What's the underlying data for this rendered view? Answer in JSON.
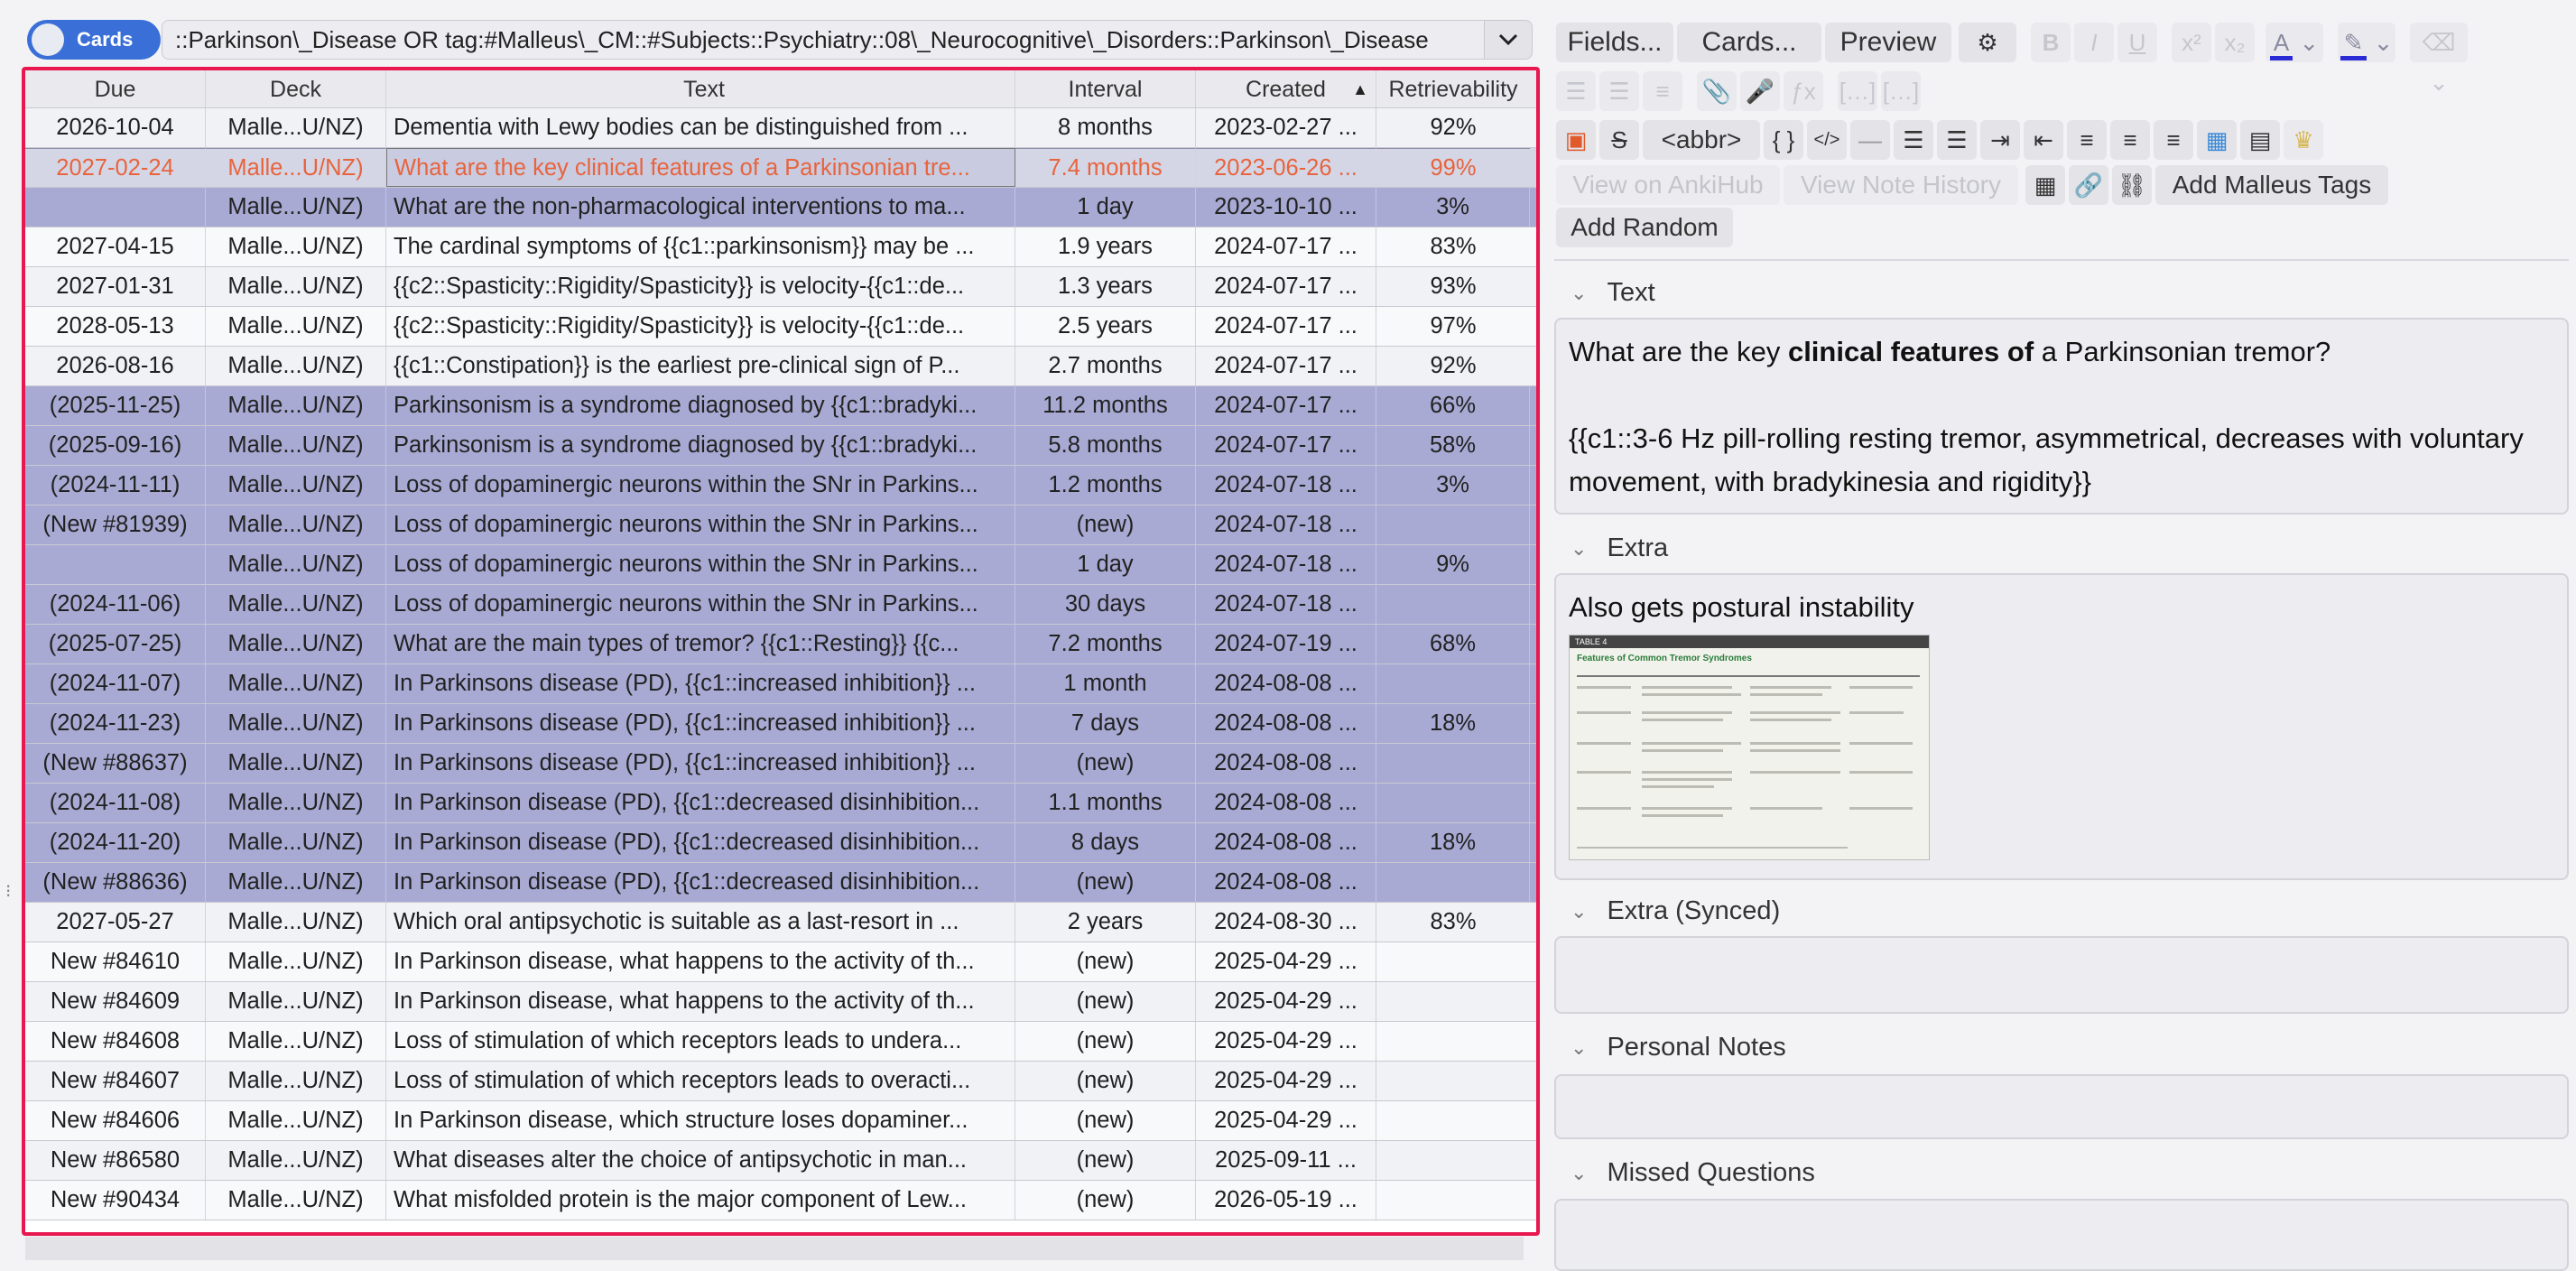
{
  "toolbar": {
    "toggle_label": "Cards",
    "search_value": "::Parkinson\\_Disease OR tag:#Malleus\\_CM::#Subjects::Psychiatry::08\\_Neurocognitive\\_Disorders::Parkinson\\_Disease",
    "dropdown_icon": "chevron-down-icon"
  },
  "table": {
    "columns": [
      "Due",
      "Deck",
      "Text",
      "Interval",
      "Created",
      "Retrievability"
    ],
    "sort_column": "Created",
    "rows": [
      {
        "due": "2026-10-04",
        "deck": "Malle...U/NZ)",
        "text": "Dementia with Lewy bodies can be distinguished from ...",
        "interval": "8 months",
        "created": "2023-02-27 ...",
        "ret": "92%",
        "state": "even"
      },
      {
        "due": "2027-02-24",
        "deck": "Malle...U/NZ)",
        "text": "What are the key clinical features of a Parkinsonian tre...",
        "interval": "7.4 months",
        "created": "2023-06-26 ...",
        "ret": "99%",
        "state": "cur"
      },
      {
        "due": "",
        "deck": "Malle...U/NZ)",
        "text": "What are the non-pharmacological interventions to ma...",
        "interval": "1 day",
        "created": "2023-10-10 ...",
        "ret": "3%",
        "state": "sel"
      },
      {
        "due": "2027-04-15",
        "deck": "Malle...U/NZ)",
        "text": "The cardinal symptoms of {{c1::parkinsonism}} may be ...",
        "interval": "1.9 years",
        "created": "2024-07-17 ...",
        "ret": "83%",
        "state": "odd"
      },
      {
        "due": "2027-01-31",
        "deck": "Malle...U/NZ)",
        "text": "{{c2::Spasticity::Rigidity/Spasticity}} is velocity-{{c1::de...",
        "interval": "1.3 years",
        "created": "2024-07-17 ...",
        "ret": "93%",
        "state": "even"
      },
      {
        "due": "2028-05-13",
        "deck": "Malle...U/NZ)",
        "text": "{{c2::Spasticity::Rigidity/Spasticity}} is velocity-{{c1::de...",
        "interval": "2.5 years",
        "created": "2024-07-17 ...",
        "ret": "97%",
        "state": "odd"
      },
      {
        "due": "2026-08-16",
        "deck": "Malle...U/NZ)",
        "text": "{{c1::Constipation}} is the earliest pre-clinical sign of P...",
        "interval": "2.7 months",
        "created": "2024-07-17 ...",
        "ret": "92%",
        "state": "even"
      },
      {
        "due": "(2025-11-25)",
        "deck": "Malle...U/NZ)",
        "text": "Parkinsonism is a syndrome diagnosed by {{c1::bradyki...",
        "interval": "11.2 months",
        "created": "2024-07-17 ...",
        "ret": "66%",
        "state": "sel"
      },
      {
        "due": "(2025-09-16)",
        "deck": "Malle...U/NZ)",
        "text": "Parkinsonism is a syndrome diagnosed by {{c1::bradyki...",
        "interval": "5.8 months",
        "created": "2024-07-17 ...",
        "ret": "58%",
        "state": "sel"
      },
      {
        "due": "(2024-11-11)",
        "deck": "Malle...U/NZ)",
        "text": "Loss of dopaminergic neurons within the SNr in Parkins...",
        "interval": "1.2 months",
        "created": "2024-07-18 ...",
        "ret": "3%",
        "state": "sel"
      },
      {
        "due": "(New #81939)",
        "deck": "Malle...U/NZ)",
        "text": "Loss of dopaminergic neurons within the SNr in Parkins...",
        "interval": "(new)",
        "created": "2024-07-18 ...",
        "ret": "",
        "state": "sel"
      },
      {
        "due": "",
        "deck": "Malle...U/NZ)",
        "text": "Loss of dopaminergic neurons within the SNr in Parkins...",
        "interval": "1 day",
        "created": "2024-07-18 ...",
        "ret": "9%",
        "state": "sel"
      },
      {
        "due": "(2024-11-06)",
        "deck": "Malle...U/NZ)",
        "text": "Loss of dopaminergic neurons within the SNr in Parkins...",
        "interval": "30 days",
        "created": "2024-07-18 ...",
        "ret": "",
        "state": "sel"
      },
      {
        "due": "(2025-07-25)",
        "deck": "Malle...U/NZ)",
        "text": "What are the main types of tremor?   {{c1::Resting}} {{c...",
        "interval": "7.2 months",
        "created": "2024-07-19 ...",
        "ret": "68%",
        "state": "sel"
      },
      {
        "due": "(2024-11-07)",
        "deck": "Malle...U/NZ)",
        "text": "In Parkinsons disease (PD), {{c1::increased inhibition}} ...",
        "interval": "1 month",
        "created": "2024-08-08 ...",
        "ret": "",
        "state": "sel"
      },
      {
        "due": "(2024-11-23)",
        "deck": "Malle...U/NZ)",
        "text": "In Parkinsons disease (PD), {{c1::increased inhibition}} ...",
        "interval": "7 days",
        "created": "2024-08-08 ...",
        "ret": "18%",
        "state": "sel"
      },
      {
        "due": "(New #88637)",
        "deck": "Malle...U/NZ)",
        "text": "In Parkinsons disease (PD), {{c1::increased inhibition}} ...",
        "interval": "(new)",
        "created": "2024-08-08 ...",
        "ret": "",
        "state": "sel"
      },
      {
        "due": "(2024-11-08)",
        "deck": "Malle...U/NZ)",
        "text": "In Parkinson disease (PD), {{c1::decreased disinhibition...",
        "interval": "1.1 months",
        "created": "2024-08-08 ...",
        "ret": "",
        "state": "sel"
      },
      {
        "due": "(2024-11-20)",
        "deck": "Malle...U/NZ)",
        "text": "In Parkinson disease (PD), {{c1::decreased disinhibition...",
        "interval": "8 days",
        "created": "2024-08-08 ...",
        "ret": "18%",
        "state": "sel"
      },
      {
        "due": "(New #88636)",
        "deck": "Malle...U/NZ)",
        "text": "In Parkinson disease (PD), {{c1::decreased disinhibition...",
        "interval": "(new)",
        "created": "2024-08-08 ...",
        "ret": "",
        "state": "sel"
      },
      {
        "due": "2027-05-27",
        "deck": "Malle...U/NZ)",
        "text": "Which oral antipsychotic is suitable as a last-resort in ...",
        "interval": "2 years",
        "created": "2024-08-30 ...",
        "ret": "83%",
        "state": "even"
      },
      {
        "due": "New #84610",
        "deck": "Malle...U/NZ)",
        "text": "In Parkinson disease, what happens to the activity of th...",
        "interval": "(new)",
        "created": "2025-04-29 ...",
        "ret": "",
        "state": "odd"
      },
      {
        "due": "New #84609",
        "deck": "Malle...U/NZ)",
        "text": "In Parkinson disease, what happens to the activity of th...",
        "interval": "(new)",
        "created": "2025-04-29 ...",
        "ret": "",
        "state": "even"
      },
      {
        "due": "New #84608",
        "deck": "Malle...U/NZ)",
        "text": "Loss of stimulation of which receptors leads to undera...",
        "interval": "(new)",
        "created": "2025-04-29 ...",
        "ret": "",
        "state": "odd"
      },
      {
        "due": "New #84607",
        "deck": "Malle...U/NZ)",
        "text": "Loss of stimulation of which receptors leads to overacti...",
        "interval": "(new)",
        "created": "2025-04-29 ...",
        "ret": "",
        "state": "even"
      },
      {
        "due": "New #84606",
        "deck": "Malle...U/NZ)",
        "text": "In Parkinson disease, which structure loses dopaminer...",
        "interval": "(new)",
        "created": "2025-04-29 ...",
        "ret": "",
        "state": "odd"
      },
      {
        "due": "New #86580",
        "deck": "Malle...U/NZ)",
        "text": "What diseases alter the choice of antipsychotic in man...",
        "interval": "(new)",
        "created": "2025-09-11 ...",
        "ret": "",
        "state": "even"
      },
      {
        "due": "New #90434",
        "deck": "Malle...U/NZ)",
        "text": "What misfolded protein is the major component of Lew...",
        "interval": "(new)",
        "created": "2026-05-19 ...",
        "ret": "",
        "state": "odd"
      }
    ]
  },
  "editor": {
    "fields_label": "Fields...",
    "cards_label": "Cards...",
    "preview_label": "Preview",
    "abbr_label": "<abbr>",
    "view_ankihub_label": "View on AnkiHub",
    "view_history_label": "View Note History",
    "add_malleus_label": "Add Malleus Tags",
    "add_random_label": "Add Random",
    "fields": {
      "text": {
        "label": "Text",
        "line1_pre": "What are the key ",
        "line1_bold": "clinical features of",
        "line1_post": " a Parkinsonian tremor?",
        "line2": "{{c1::3-6 Hz pill-rolling resting tremor, asymmetrical, decreases with voluntary movement, with bradykinesia and rigidity}}"
      },
      "extra": {
        "label": "Extra",
        "value": "Also gets postural instability",
        "image_header": "TABLE 4",
        "image_title": "Features of Common Tremor Syndromes"
      },
      "extra_synced": {
        "label": "Extra (Synced)"
      },
      "personal_notes": {
        "label": "Personal Notes"
      },
      "missed_questions": {
        "label": "Missed Questions"
      }
    }
  },
  "colors": {
    "accent_border": "#e8174f",
    "selected_row": "#a8aad4",
    "current_row_text": "#e8643d",
    "toggle_blue": "#3a6fd8"
  }
}
